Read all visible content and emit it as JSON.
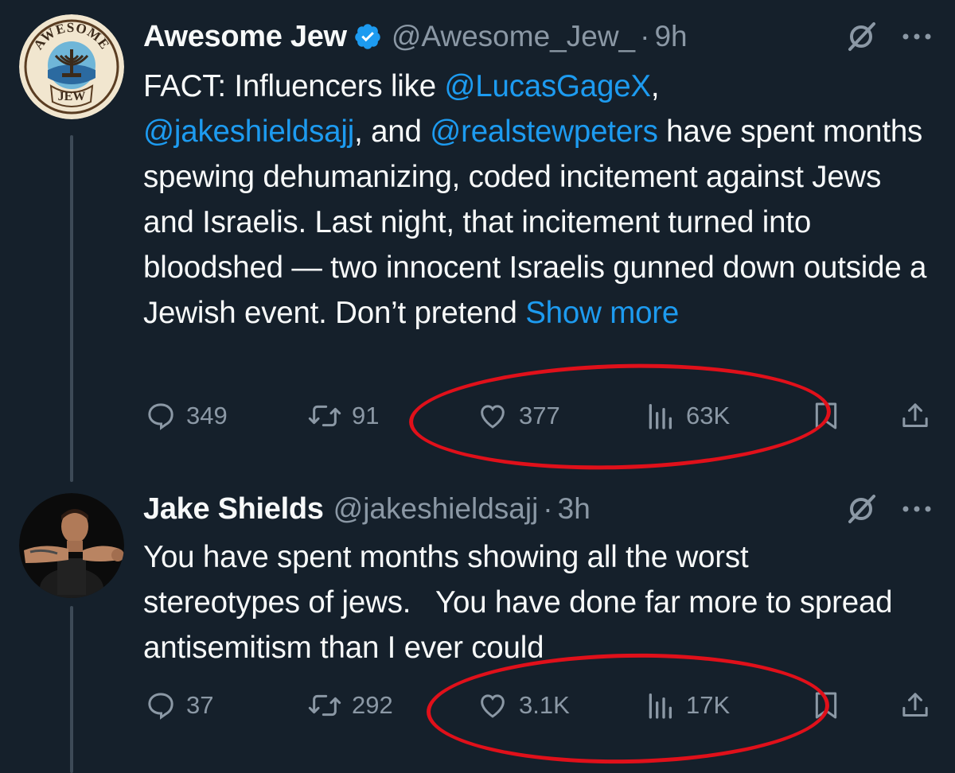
{
  "tweets": [
    {
      "name": "Awesome Jew",
      "handle": "@Awesome_Jew_",
      "separator": "·",
      "time": "9h",
      "verified": true,
      "avatar_text_top": "AWESOME",
      "avatar_text_bottom": "JEW",
      "body": {
        "p1": "FACT: Influencers like ",
        "m1": "@LucasGageX",
        "p2": ",",
        "m2": "@jakeshieldsajj",
        "p3": ", and ",
        "m3": "@realstewpeters",
        "p4": " have spent months spewing dehumanizing, coded incitement against Jews and Israelis. Last night, that incitement turned into bloodshed — two innocent Israelis gunned down outside a Jewish event. Don’t pretend ",
        "show_more": "Show more"
      },
      "actions": {
        "replies": "349",
        "reposts": "91",
        "likes": "377",
        "views": "63K"
      }
    },
    {
      "name": "Jake Shields",
      "handle": "@jakeshieldsajj",
      "separator": "·",
      "time": "3h",
      "verified": false,
      "body": {
        "text": "You have spent months showing all the worst stereotypes of jews.   You have done far more to spread antisemitism than I ever could"
      },
      "actions": {
        "replies": "37",
        "reposts": "292",
        "likes": "3.1K",
        "views": "17K"
      }
    }
  ],
  "icons": {
    "reply": "reply-icon",
    "repost": "repost-icon",
    "like": "heart-icon",
    "views": "views-chart-icon",
    "bookmark": "bookmark-icon",
    "share": "share-icon",
    "grok": "grok-icon",
    "more": "more-dots-icon",
    "verified": "verified-badge-icon"
  },
  "colors": {
    "background": "#15202b",
    "text": "#f7f9f9",
    "muted": "#8b98a5",
    "link": "#1d9bf0",
    "annotation": "#e0101a"
  }
}
